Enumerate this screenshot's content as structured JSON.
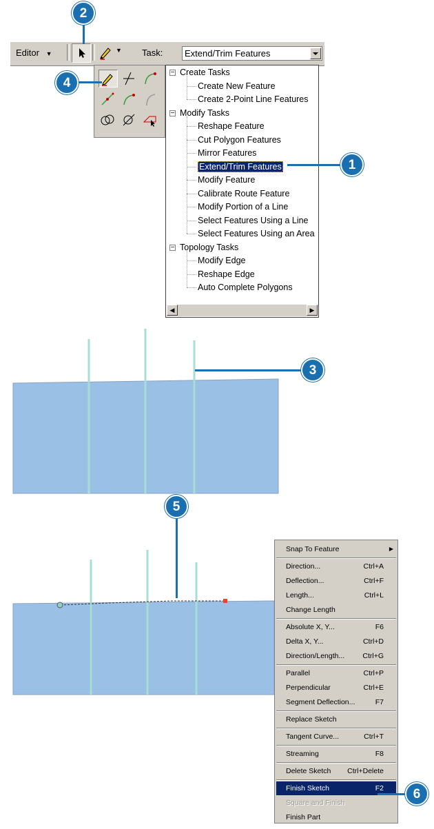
{
  "callouts": [
    "1",
    "2",
    "3",
    "4",
    "5",
    "6"
  ],
  "toolbar": {
    "editor_label": "Editor",
    "task_label": "Task:",
    "task_value": "Extend/Trim Features",
    "editor_icon": "dropdown-arrow-icon",
    "sketch_icon": "pencil-icon",
    "edit_icon": "arrow-pointer-icon"
  },
  "tasks": {
    "groups": [
      {
        "label": "Create Tasks",
        "items": [
          "Create New Feature",
          "Create 2-Point Line Features"
        ]
      },
      {
        "label": "Modify Tasks",
        "items": [
          "Reshape Feature",
          "Cut Polygon Features",
          "Mirror Features",
          "Extend/Trim Features",
          "Modify Feature",
          "Calibrate Route Feature",
          "Modify Portion of a Line",
          "Select Features Using a Line",
          "Select Features Using an Area"
        ]
      },
      {
        "label": "Topology Tasks",
        "items": [
          "Modify Edge",
          "Reshape Edge",
          "Auto Complete Polygons"
        ]
      }
    ],
    "selected": "Extend/Trim Features"
  },
  "palette_tools": [
    "sketch-pencil-icon",
    "intersection-icon",
    "arc-icon",
    "midpoint-icon",
    "end-point-arc-icon",
    "tangent-curve-icon",
    "distance-distance-icon",
    "direction-distance-icon",
    "trace-icon"
  ],
  "colors": {
    "map_fill": "#9bc0e6",
    "line": "#a8dcd6",
    "callout": "#1a6fb0",
    "highlight": "#0a246a",
    "vertex": "#e8472c"
  },
  "context_menu": {
    "items": [
      {
        "label": "Snap To Feature",
        "shortcut": "",
        "submenu": true
      },
      {
        "label": "Direction...",
        "shortcut": "Ctrl+A"
      },
      {
        "label": "Deflection...",
        "shortcut": "Ctrl+F"
      },
      {
        "label": "Length...",
        "shortcut": "Ctrl+L"
      },
      {
        "label": "Change Length",
        "shortcut": ""
      },
      {
        "label": "Absolute X, Y...",
        "shortcut": "F6"
      },
      {
        "label": "Delta X, Y...",
        "shortcut": "Ctrl+D"
      },
      {
        "label": "Direction/Length...",
        "shortcut": "Ctrl+G"
      },
      {
        "label": "Parallel",
        "shortcut": "Ctrl+P"
      },
      {
        "label": "Perpendicular",
        "shortcut": "Ctrl+E"
      },
      {
        "label": "Segment Deflection...",
        "shortcut": "F7"
      },
      {
        "label": "Replace Sketch",
        "shortcut": ""
      },
      {
        "label": "Tangent Curve...",
        "shortcut": "Ctrl+T"
      },
      {
        "label": "Streaming",
        "shortcut": "F8"
      },
      {
        "label": "Delete Sketch",
        "shortcut": "Ctrl+Delete"
      },
      {
        "label": "Finish Sketch",
        "shortcut": "F2",
        "highlighted": true
      },
      {
        "label": "Square and Finish",
        "shortcut": "",
        "disabled": true
      },
      {
        "label": "Finish Part",
        "shortcut": ""
      }
    ]
  }
}
